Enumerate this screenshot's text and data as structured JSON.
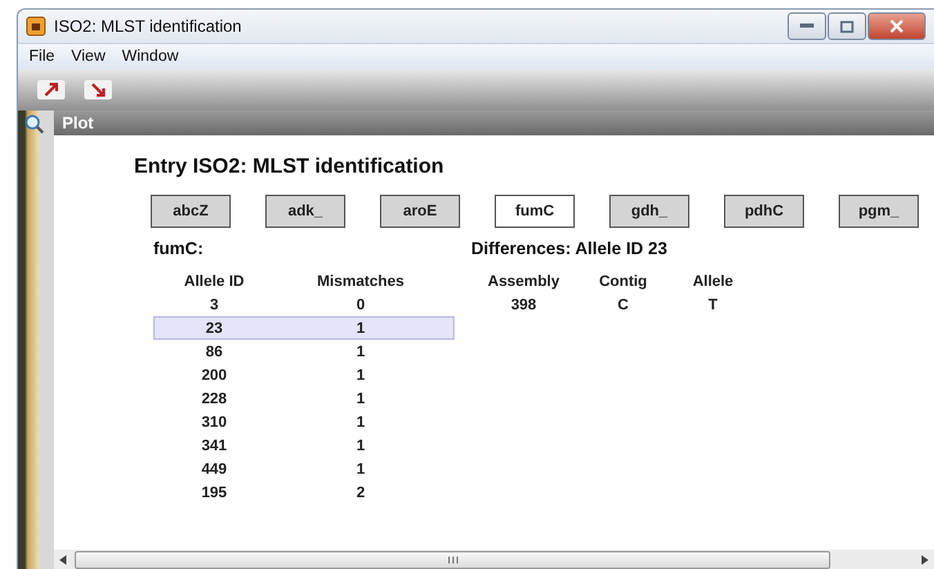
{
  "window": {
    "title": "ISO2: MLST identification"
  },
  "menu": [
    "File",
    "View",
    "Window"
  ],
  "panel": {
    "title": "Plot"
  },
  "heading": "Entry ISO2: MLST identification",
  "genes": [
    {
      "label": "abcZ",
      "selected": false
    },
    {
      "label": "adk_",
      "selected": false
    },
    {
      "label": "aroE",
      "selected": false
    },
    {
      "label": "fumC",
      "selected": true
    },
    {
      "label": "gdh_",
      "selected": false
    },
    {
      "label": "pdhC",
      "selected": false
    },
    {
      "label": "pgm_",
      "selected": false
    }
  ],
  "alleles": {
    "title": "fumC:",
    "columns": [
      "Allele ID",
      "Mismatches"
    ],
    "rows": [
      {
        "cells": [
          "3",
          "0"
        ],
        "selected": false
      },
      {
        "cells": [
          "23",
          "1"
        ],
        "selected": true
      },
      {
        "cells": [
          "86",
          "1"
        ],
        "selected": false
      },
      {
        "cells": [
          "200",
          "1"
        ],
        "selected": false
      },
      {
        "cells": [
          "228",
          "1"
        ],
        "selected": false
      },
      {
        "cells": [
          "310",
          "1"
        ],
        "selected": false
      },
      {
        "cells": [
          "341",
          "1"
        ],
        "selected": false
      },
      {
        "cells": [
          "449",
          "1"
        ],
        "selected": false
      },
      {
        "cells": [
          "195",
          "2"
        ],
        "selected": false
      }
    ]
  },
  "differences": {
    "title": "Differences: Allele ID 23",
    "columns": [
      "Assembly",
      "Contig",
      "Allele"
    ],
    "rows": [
      {
        "cells": [
          "398",
          "C",
          "T"
        ]
      }
    ]
  }
}
